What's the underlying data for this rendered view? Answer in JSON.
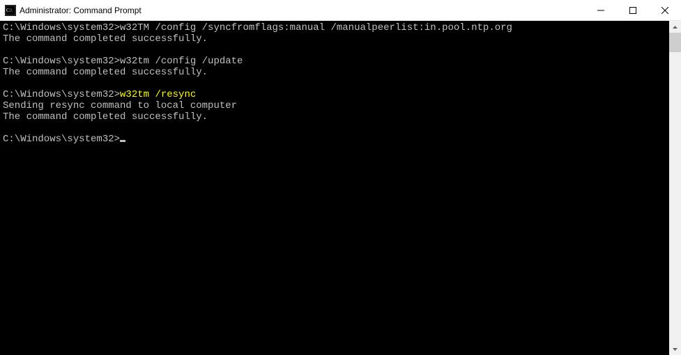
{
  "titlebar": {
    "title": "Administrator: Command Prompt"
  },
  "console": {
    "blocks": [
      {
        "prompt": "C:\\Windows\\system32>",
        "command": "w32TM /config /syncfromflags:manual /manualpeerlist:in.pool.ntp.org",
        "highlight": false,
        "output": [
          "The command completed successfully."
        ]
      },
      {
        "prompt": "C:\\Windows\\system32>",
        "command": "w32tm /config /update",
        "highlight": false,
        "output": [
          "The command completed successfully."
        ]
      },
      {
        "prompt": "C:\\Windows\\system32>",
        "command": "w32tm /resync",
        "highlight": true,
        "output": [
          "Sending resync command to local computer",
          "The command completed successfully."
        ]
      }
    ],
    "current_prompt": "C:\\Windows\\system32>"
  }
}
